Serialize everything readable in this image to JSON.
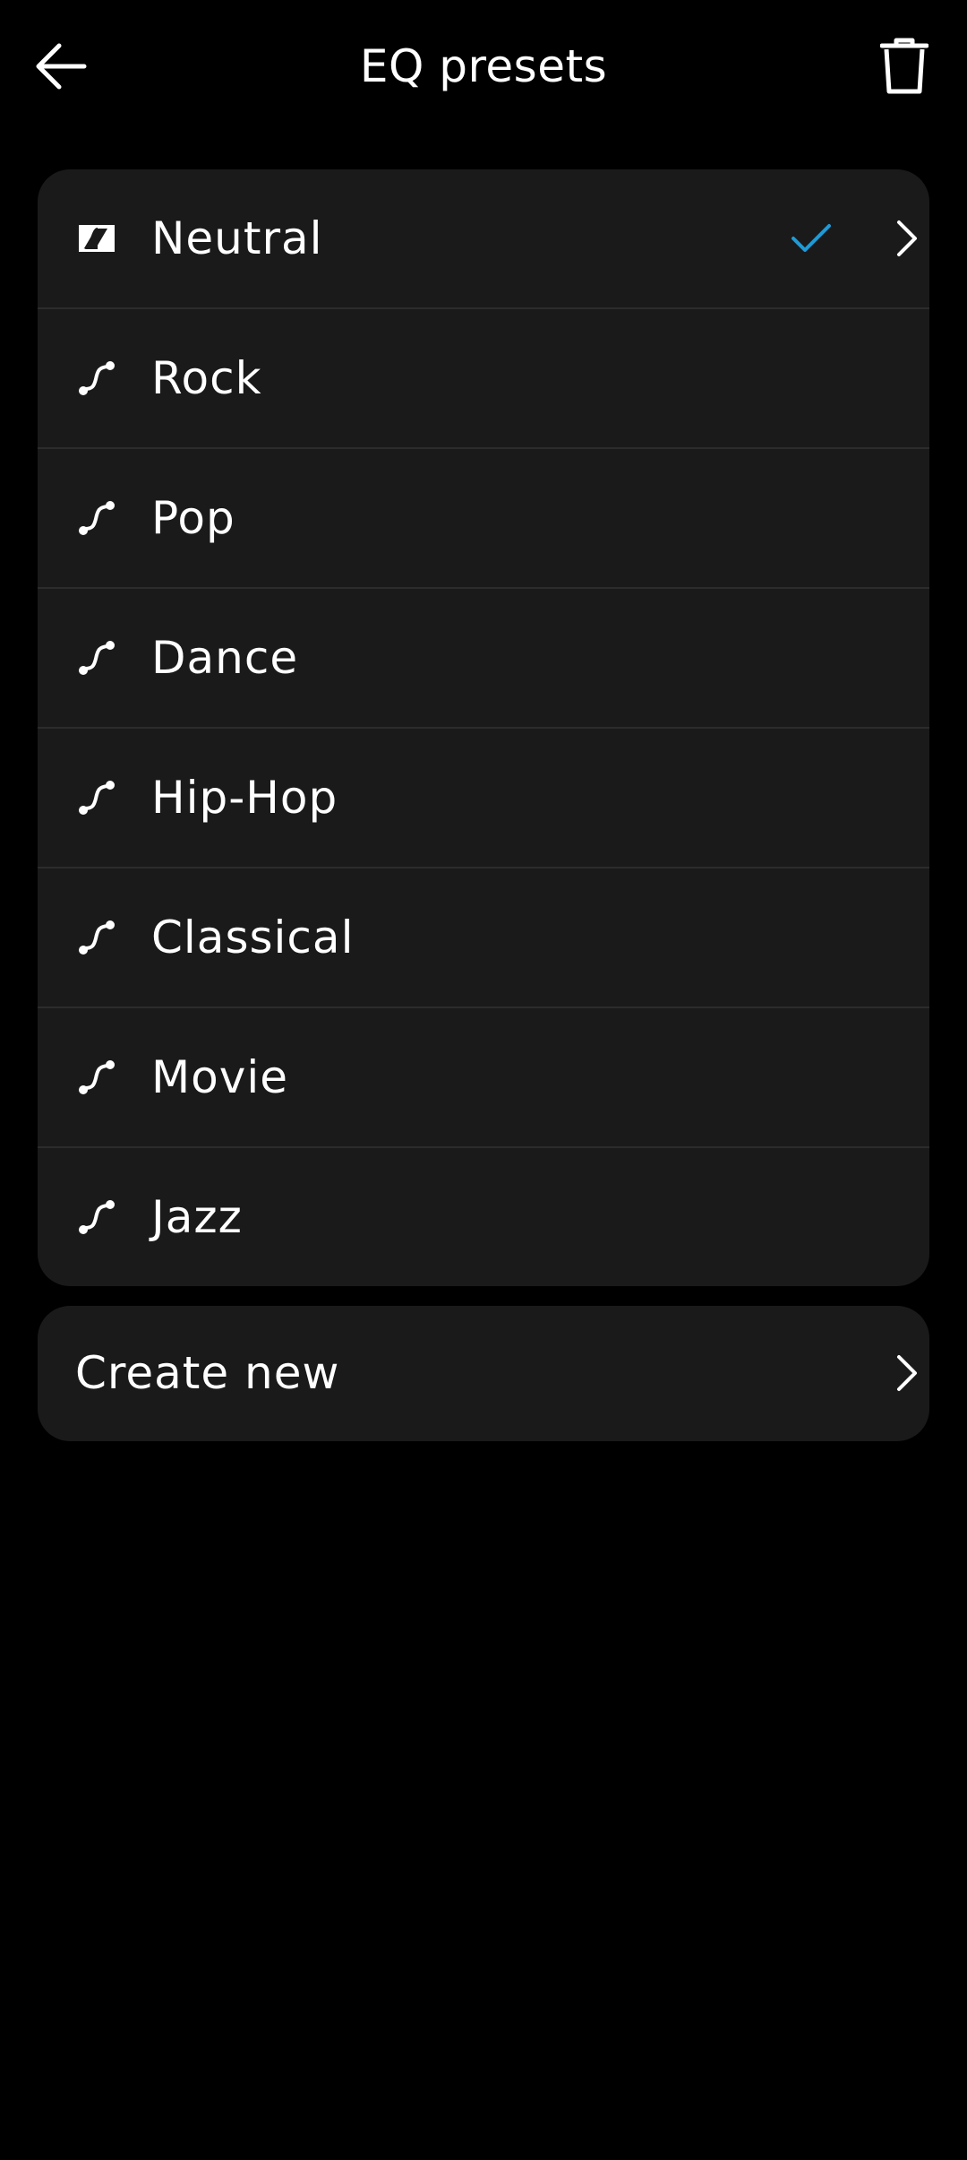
{
  "header": {
    "title": "EQ presets",
    "back_icon": "arrow-left-icon",
    "delete_icon": "trash-icon"
  },
  "presets": [
    {
      "label": "Neutral",
      "icon": "neutral-preset-icon",
      "selected": true
    },
    {
      "label": "Rock",
      "icon": "eq-curve-icon",
      "selected": false
    },
    {
      "label": "Pop",
      "icon": "eq-curve-icon",
      "selected": false
    },
    {
      "label": "Dance",
      "icon": "eq-curve-icon",
      "selected": false
    },
    {
      "label": "Hip-Hop",
      "icon": "eq-curve-icon",
      "selected": false
    },
    {
      "label": "Classical",
      "icon": "eq-curve-icon",
      "selected": false
    },
    {
      "label": "Movie",
      "icon": "eq-curve-icon",
      "selected": false
    },
    {
      "label": "Jazz",
      "icon": "eq-curve-icon",
      "selected": false
    }
  ],
  "create_new": {
    "label": "Create new",
    "icon": "chevron-right-icon"
  },
  "colors": {
    "background": "#000000",
    "card": "#1a1a1a",
    "divider": "#2c2c2c",
    "text": "#ffffff",
    "accent_check": "#1e9bd7"
  }
}
